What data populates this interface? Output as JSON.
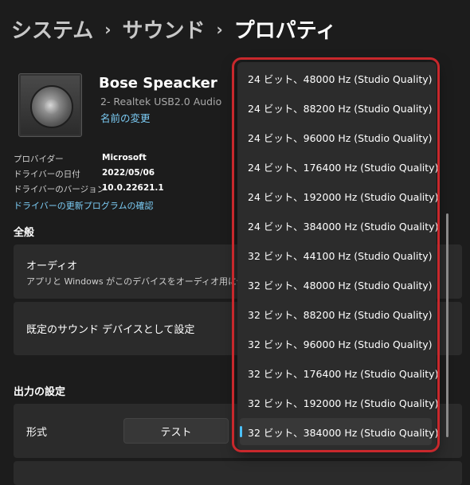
{
  "breadcrumb": {
    "items": [
      "システム",
      "サウンド"
    ],
    "separator": "›",
    "current": "プロパティ"
  },
  "device": {
    "name": "Bose Speacker",
    "subtitle": "2- Realtek USB2.0 Audio",
    "rename_link": "名前の変更",
    "icon": "speaker-icon"
  },
  "driver_info": {
    "rows": [
      {
        "label": "プロバイダー",
        "value": "Microsoft"
      },
      {
        "label": "ドライバーの日付",
        "value": "2022/05/06"
      },
      {
        "label": "ドライバーのバージョン",
        "value": "10.0.22621.1"
      }
    ],
    "update_link": "ドライバーの更新プログラムの確認"
  },
  "general": {
    "heading": "全般",
    "audio_title": "オーディオ",
    "audio_desc": "アプリと Windows がこのデバイスをオーディオ用に使用す",
    "default_device_title": "既定のサウンド デバイスとして設定"
  },
  "output": {
    "heading": "出力の設定",
    "format_label": "形式",
    "test_button": "テスト"
  },
  "format_dropdown": {
    "options": [
      "24 ビット、48000 Hz (Studio Quality)",
      "24 ビット、88200 Hz (Studio Quality)",
      "24 ビット、96000 Hz (Studio Quality)",
      "24 ビット、176400 Hz (Studio Quality)",
      "24 ビット、192000 Hz (Studio Quality)",
      "24 ビット、384000 Hz (Studio Quality)",
      "32 ビット、44100 Hz (Studio Quality)",
      "32 ビット、48000 Hz (Studio Quality)",
      "32 ビット、88200 Hz (Studio Quality)",
      "32 ビット、96000 Hz (Studio Quality)",
      "32 ビット、176400 Hz (Studio Quality)",
      "32 ビット、192000 Hz (Studio Quality)",
      "32 ビット、384000 Hz (Studio Quality)"
    ],
    "selected": "32 ビット、384000 Hz (Studio Quality)"
  },
  "colors": {
    "background": "#1c1c1c",
    "card": "#2b2b2b",
    "accent": "#4cc2ff",
    "link": "#7ccdf6",
    "highlight_ring": "#c8282c"
  }
}
